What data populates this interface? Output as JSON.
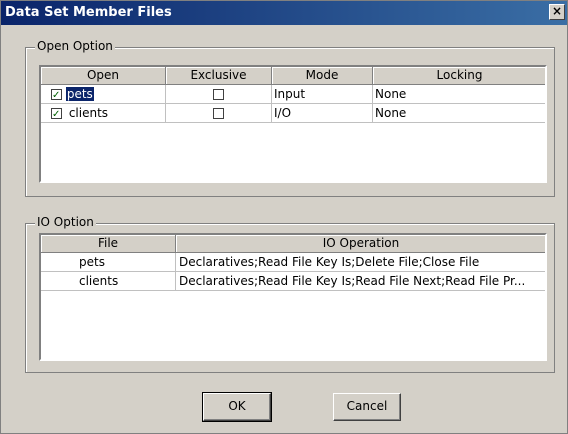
{
  "window": {
    "title": "Data Set Member Files",
    "close_glyph": "×"
  },
  "open_option": {
    "label": "Open Option",
    "headers": [
      "Open",
      "Exclusive",
      "Mode",
      "Locking"
    ],
    "rows": [
      {
        "name": "pets",
        "open_checked": true,
        "exclusive_checked": false,
        "mode": "Input",
        "locking": "None",
        "selected": true
      },
      {
        "name": "clients",
        "open_checked": true,
        "exclusive_checked": false,
        "mode": "I/O",
        "locking": "None",
        "selected": false
      }
    ]
  },
  "io_option": {
    "label": "IO Option",
    "headers": [
      "File",
      "IO Operation"
    ],
    "rows": [
      {
        "file": "pets",
        "operation": "Declaratives;Read File Key Is;Delete File;Close File"
      },
      {
        "file": "clients",
        "operation": "Declaratives;Read File Key Is;Read File Next;Read File Pr..."
      }
    ]
  },
  "buttons": {
    "ok": "OK",
    "cancel": "Cancel"
  }
}
